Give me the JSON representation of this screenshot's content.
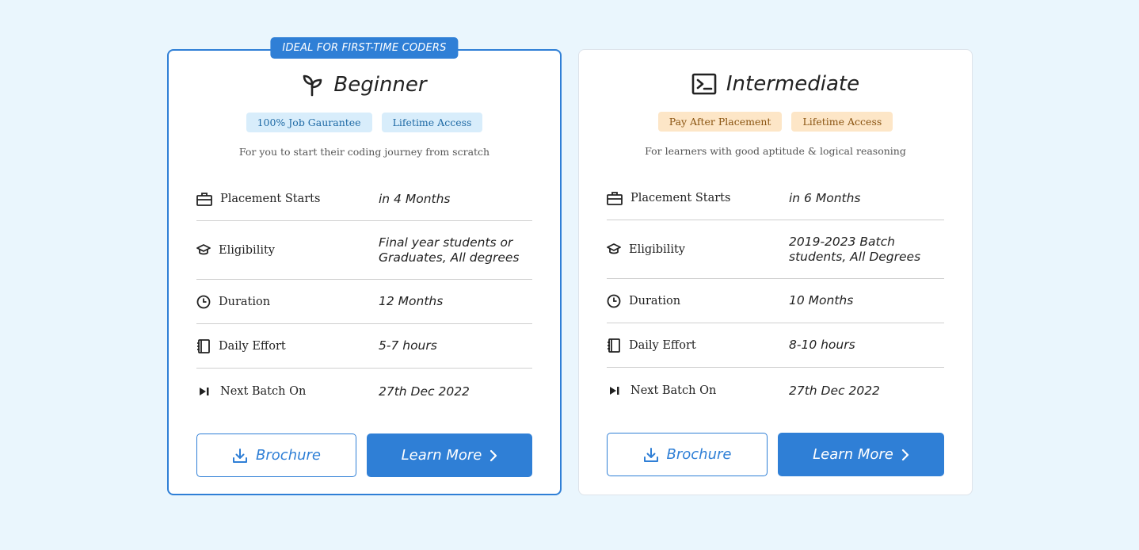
{
  "plans": [
    {
      "ribbon": "IDEAL FOR FIRST-TIME CODERS",
      "title": "Beginner",
      "icon": "sprout-icon",
      "tags": [
        "100% Job Gaurantee",
        "Lifetime Access"
      ],
      "subtitle": "For you to start their coding journey from scratch",
      "rows": [
        {
          "label": "Placement Starts",
          "value": "in 4 Months"
        },
        {
          "label": "Eligibility",
          "value_lines": [
            "Final year students or",
            "Graduates, All degrees"
          ]
        },
        {
          "label": "Duration",
          "value": "12 Months"
        },
        {
          "label": "Daily Effort",
          "value": "5-7 hours"
        },
        {
          "label": "Next Batch On",
          "value": "27th Dec 2022"
        }
      ],
      "brochure_label": "Brochure",
      "learn_more_label": "Learn More"
    },
    {
      "title": "Intermediate",
      "icon": "terminal-icon",
      "tags": [
        "Pay After Placement",
        "Lifetime Access"
      ],
      "subtitle": "For learners with good aptitude & logical reasoning",
      "rows": [
        {
          "label": "Placement Starts",
          "value": "in 6 Months"
        },
        {
          "label": "Eligibility",
          "value_lines": [
            "2019-2023 Batch",
            "students, All Degrees"
          ]
        },
        {
          "label": "Duration",
          "value": "10 Months"
        },
        {
          "label": "Daily Effort",
          "value": "8-10 hours"
        },
        {
          "label": "Next Batch On",
          "value": "27th Dec 2022"
        }
      ],
      "brochure_label": "Brochure",
      "learn_more_label": "Learn More"
    }
  ],
  "colors": {
    "background": "#eaf6fd",
    "accent": "#2f7fd6",
    "tag_blue_bg": "#d8edfb",
    "tag_orange_bg": "#fde6c7"
  }
}
